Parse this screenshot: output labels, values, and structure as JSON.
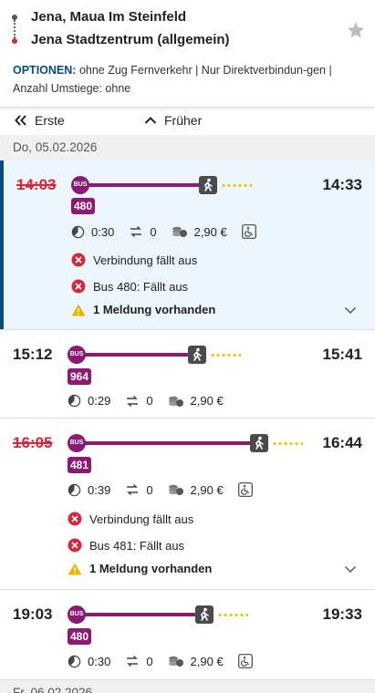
{
  "header": {
    "from": "Jena, Maua Im Steinfeld",
    "to": "Jena Stadtzentrum (allgemein)",
    "options_label": "OPTIONEN:",
    "options_text": "ohne Zug Fernverkehr | Nur Direktverbindun-gen | Anzahl Umstiege: ohne"
  },
  "nav": {
    "first_label": "Erste",
    "earlier_label": "Früher"
  },
  "date_band_1": "Do, 05.02.2026",
  "date_band_2": "Fr, 06.02.2026",
  "bus_icon_text": "BUS",
  "connections": [
    {
      "dep": "14:03",
      "arr": "14:33",
      "line": "480",
      "duration": "0:30",
      "transfers": "0",
      "price": "2,90 €",
      "msg1": "Verbindung fällt aus",
      "msg2": "Bus 480: Fällt aus",
      "notice": "1 Meldung vorhanden"
    },
    {
      "dep": "15:12",
      "arr": "15:41",
      "line": "964",
      "duration": "0:29",
      "transfers": "0",
      "price": "2,90 €"
    },
    {
      "dep": "16:05",
      "arr": "16:44",
      "line": "481",
      "duration": "0:39",
      "transfers": "0",
      "price": "2,90 €",
      "msg1": "Verbindung fällt aus",
      "msg2": "Bus 481: Fällt aus",
      "notice": "1 Meldung vorhanden"
    },
    {
      "dep": "19:03",
      "arr": "19:33",
      "line": "480",
      "duration": "0:30",
      "transfers": "0",
      "price": "2,90 €"
    }
  ],
  "colors": {
    "bus": "#8b1a74",
    "cancel": "#d6263a",
    "accent": "#0a4a7c",
    "walk_dots": "#f2c200",
    "warning": "#f2b200"
  },
  "icons": [
    "star-icon",
    "double-chevron-left-icon",
    "chevron-up-icon",
    "clock-icon",
    "transfer-icon",
    "coins-icon",
    "wheelchair-icon",
    "cancel-icon",
    "warning-icon",
    "chevron-down-icon",
    "walk-icon",
    "bus-icon"
  ]
}
